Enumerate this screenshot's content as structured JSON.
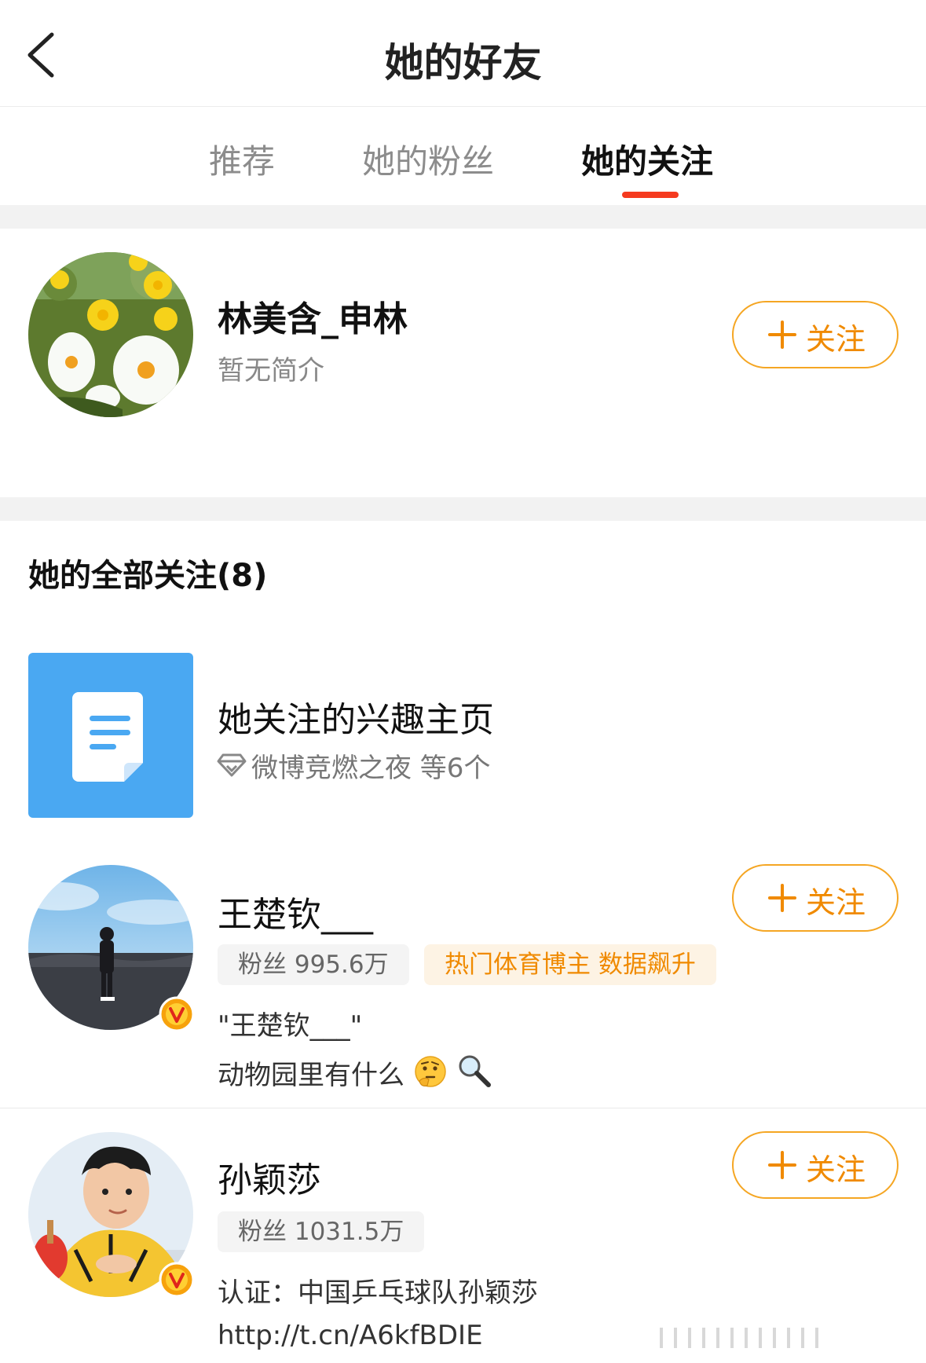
{
  "header": {
    "title": "她的好友",
    "back_icon": "chevron-left-icon"
  },
  "tabs": [
    {
      "label": "推荐",
      "active": false
    },
    {
      "label": "她的粉丝",
      "active": false
    },
    {
      "label": "她的关注",
      "active": true
    }
  ],
  "accent_color": "#f53a1f",
  "follow_color": "#f5a623",
  "profile_card": {
    "name": "林美含_申林",
    "bio": "暂无简介",
    "avatar_icon": "flower-avatar",
    "follow_label": "关注"
  },
  "following_section": {
    "title": "她的全部关注(8)"
  },
  "interest_item": {
    "title": "她关注的兴趣主页",
    "detail": "微博竞燃之夜 等6个",
    "icon": "document-icon",
    "color": "#4aa8f2"
  },
  "users": [
    {
      "name": "王楚钦___",
      "fans": "粉丝 995.6万",
      "tag": "热门体育博主 数据飙升",
      "line1": "\"王楚钦___\"",
      "line2": "动物园里有什么",
      "line2_emojis": [
        "thinking-face-icon",
        "magnifier-icon"
      ],
      "verified": true,
      "follow_label": "关注"
    },
    {
      "name": "孙颖莎",
      "fans": "粉丝 1031.5万",
      "line1": "认证：中国乒乓球队孙颖莎",
      "line2": "http://t.cn/A6kfBDIE",
      "verified": true,
      "follow_label": "关注"
    }
  ]
}
